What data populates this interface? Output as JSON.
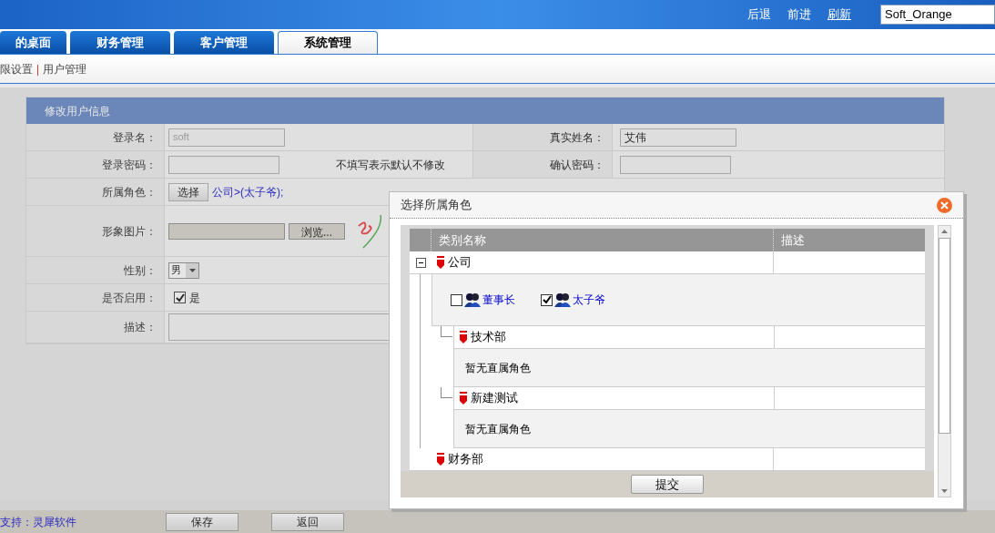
{
  "header": {
    "nav_links": [
      {
        "label": "后退",
        "underlined": false
      },
      {
        "label": "前进",
        "underlined": false
      },
      {
        "label": "刷新",
        "underlined": true
      }
    ],
    "theme_select": {
      "value": "Soft_Orange"
    }
  },
  "tabs": [
    {
      "label": "的桌面",
      "selected": false
    },
    {
      "label": "财务管理",
      "selected": false
    },
    {
      "label": "客户管理",
      "selected": false
    },
    {
      "label": "系统管理",
      "selected": true
    }
  ],
  "subnav": {
    "items": [
      "限设置",
      "用户管理"
    ],
    "separator": "|"
  },
  "form": {
    "title": "修改用户信息",
    "login_name": {
      "label": "登录名：",
      "value": "soft"
    },
    "real_name": {
      "label": "真实姓名：",
      "value": "艾伟"
    },
    "password": {
      "label": "登录密码：",
      "hint": "不填写表示默认不修改"
    },
    "confirm": {
      "label": "确认密码："
    },
    "role": {
      "label": "所属角色：",
      "button": "选择",
      "value": "公司>(太子爷);"
    },
    "image": {
      "label": "形象图片：",
      "button": "浏览..."
    },
    "gender": {
      "label": "性别：",
      "value": "男"
    },
    "enabled": {
      "label": "是否启用：",
      "checked": true,
      "text": "是"
    },
    "description": {
      "label": "描述："
    }
  },
  "modal": {
    "title": "选择所属角色",
    "columns": [
      "类别名称",
      "描述"
    ],
    "tree": [
      {
        "name": "公司",
        "expanded": true,
        "roles": [
          {
            "name": "董事长",
            "checked": false
          },
          {
            "name": "太子爷",
            "checked": true
          }
        ],
        "children": [
          {
            "name": "技术部",
            "note": "暂无直属角色"
          },
          {
            "name": "新建测试",
            "note": "暂无直属角色"
          }
        ]
      },
      {
        "name": "财务部"
      }
    ],
    "submit": "提交"
  },
  "footer": {
    "support": "支持：灵犀软件",
    "buttons": [
      "保存",
      "返回"
    ]
  }
}
